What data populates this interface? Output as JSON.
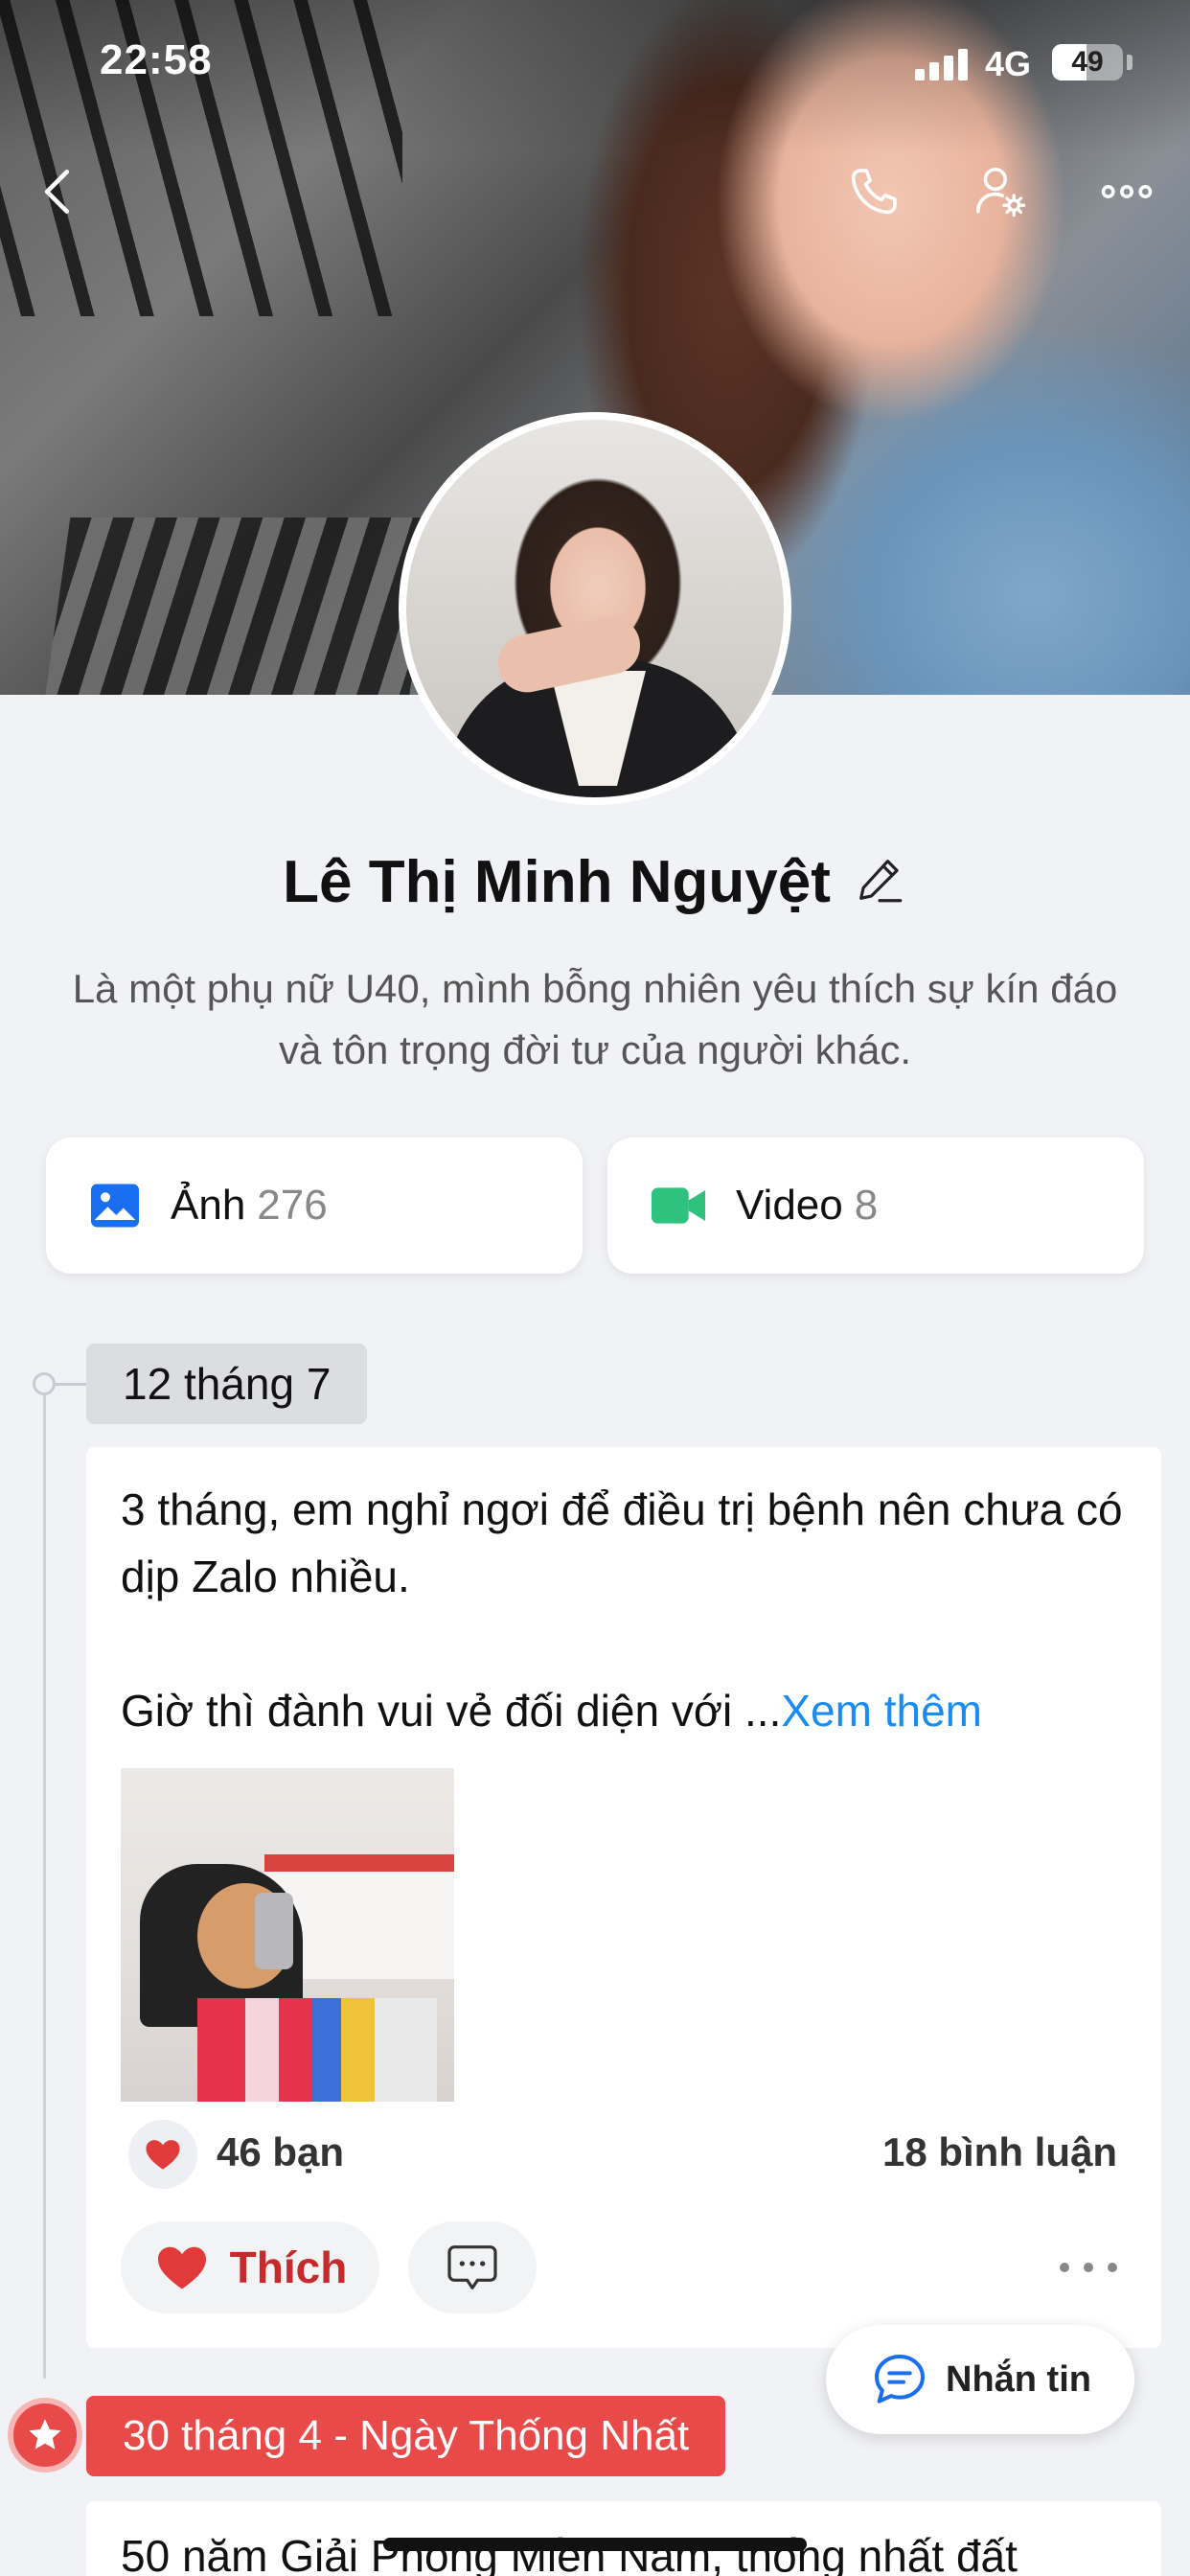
{
  "status_bar": {
    "time": "22:58",
    "network": "4G",
    "battery": "49",
    "battery_level": 0.49
  },
  "header": {
    "back_icon": "chevron-left-icon",
    "call_icon": "phone-icon",
    "settings_icon": "user-settings-icon",
    "more_icon": "more-horizontal-icon"
  },
  "profile": {
    "name": "Lê Thị Minh Nguyệt",
    "bio": "Là một phụ nữ U40, mình bỗng nhiên yêu thích sự kín đáo và tôn trọng đời tư của người khác."
  },
  "albums": [
    {
      "label": "Ảnh",
      "count": "276",
      "icon": "photo-icon",
      "color": "#1a6ff0"
    },
    {
      "label": "Video",
      "count": "8",
      "icon": "video-camera-icon",
      "color": "#2ec27e"
    }
  ],
  "timeline": {
    "posts": [
      {
        "date": "12 tháng 7",
        "text": "3 tháng, em nghỉ ngơi để điều trị bệnh nên chưa có dịp Zalo nhiều.\n\nGiờ thì đành vui vẻ đối diện với ...",
        "see_more": "Xem thêm",
        "likes": "46 bạn",
        "comments": "18 bình luận",
        "like_label": "Thích"
      },
      {
        "date": "30 tháng 4 - Ngày Thống Nhất",
        "text": "50 năm Giải Phóng Miền Nam, thống nhất đất"
      }
    ]
  },
  "message_button": {
    "label": "Nhắn tin"
  },
  "colors": {
    "accent_blue": "#1a8cf0",
    "like_red": "#e03a3a",
    "event_red": "#e84a4a"
  }
}
